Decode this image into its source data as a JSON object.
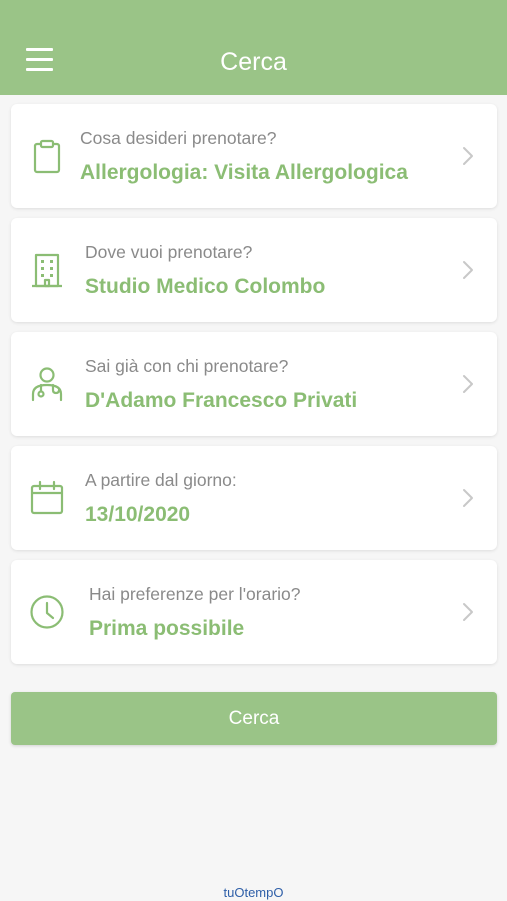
{
  "header": {
    "title": "Cerca",
    "menu_icon": "hamburger-menu-icon",
    "background_color": "#9ac487"
  },
  "cards": [
    {
      "icon": "clipboard-icon",
      "label": "Cosa desideri prenotare?",
      "value": "Allergologia: Visita Allergologica"
    },
    {
      "icon": "building-icon",
      "label": "Dove vuoi prenotare?",
      "value": "Studio Medico Colombo"
    },
    {
      "icon": "doctor-icon",
      "label": "Sai già con chi prenotare?",
      "value": "D'Adamo Francesco Privati"
    },
    {
      "icon": "calendar-icon",
      "label": "A partire dal giorno:",
      "value": "13/10/2020"
    },
    {
      "icon": "clock-icon",
      "label": "Hai preferenze per l'orario?",
      "value": "Prima possibile"
    }
  ],
  "search_button": {
    "label": "Cerca"
  },
  "footer": {
    "brand": "tuOtempO"
  },
  "colors": {
    "accent": "#9ac487",
    "value_text": "#8bbd74",
    "label_text": "#8a8a8a",
    "brand_text": "#2f5fa8"
  }
}
